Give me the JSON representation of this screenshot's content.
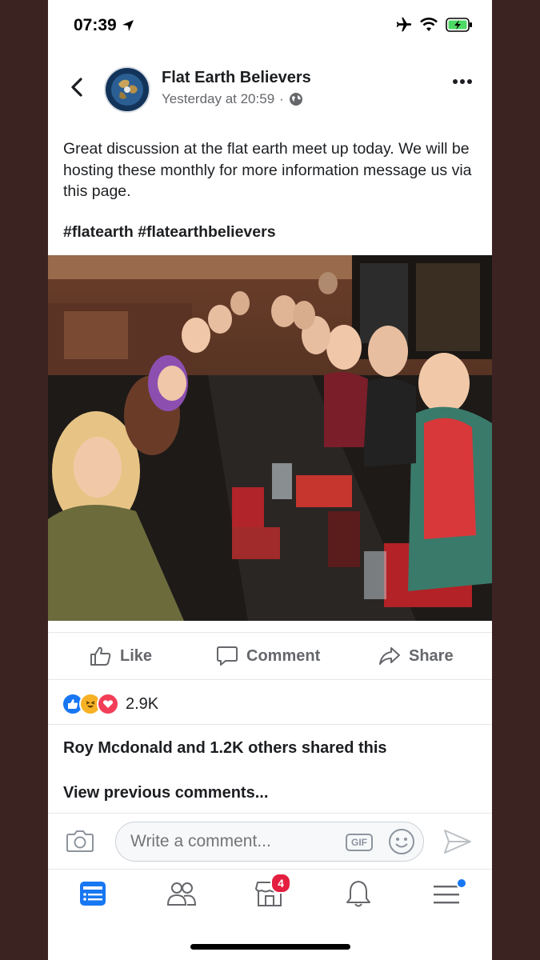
{
  "status_bar": {
    "time": "07:39"
  },
  "post": {
    "page_name": "Flat Earth Believers",
    "timestamp": "Yesterday at 20:59",
    "body_text": "Great discussion at the flat earth meet up today. We will be hosting these monthly for more information message us via this page.",
    "hashtags": [
      "#flatearth",
      "#flatearthbelievers"
    ]
  },
  "actions": {
    "like": "Like",
    "comment": "Comment",
    "share": "Share"
  },
  "engagement": {
    "reaction_count": "2.9K",
    "shared_text": "Roy Mcdonald and 1.2K others shared this",
    "view_previous": "View previous comments..."
  },
  "comment_bar": {
    "placeholder": "Write a comment...",
    "gif_label": "GIF"
  },
  "tab_bar": {
    "marketplace_badge": "4"
  },
  "colors": {
    "accent": "#1877f2",
    "badge": "#e41e3f",
    "love": "#f33e58",
    "haha": "#f7b125"
  }
}
